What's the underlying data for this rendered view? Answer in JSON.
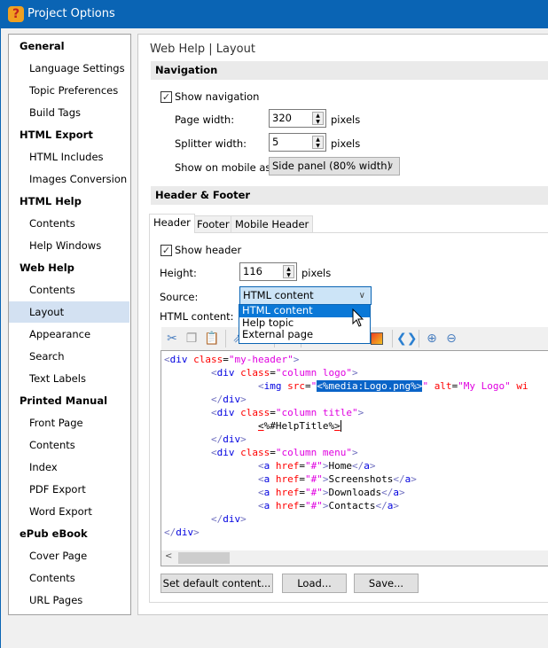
{
  "window": {
    "title": "Project Options",
    "icon": "help-question-icon"
  },
  "sidebar": {
    "items": [
      {
        "label": "General",
        "group": true
      },
      {
        "label": "Language Settings"
      },
      {
        "label": "Topic Preferences"
      },
      {
        "label": "Build Tags"
      },
      {
        "label": "HTML Export",
        "group": true
      },
      {
        "label": "HTML Includes"
      },
      {
        "label": "Images Conversion"
      },
      {
        "label": "HTML Help",
        "group": true
      },
      {
        "label": "Contents"
      },
      {
        "label": "Help Windows"
      },
      {
        "label": "Web Help",
        "group": true
      },
      {
        "label": "Contents"
      },
      {
        "label": "Layout",
        "selected": true
      },
      {
        "label": "Appearance"
      },
      {
        "label": "Search"
      },
      {
        "label": "Text Labels"
      },
      {
        "label": "Printed Manual",
        "group": true
      },
      {
        "label": "Front Page"
      },
      {
        "label": "Contents"
      },
      {
        "label": "Index"
      },
      {
        "label": "PDF Export"
      },
      {
        "label": "Word Export"
      },
      {
        "label": "ePub eBook",
        "group": true
      },
      {
        "label": "Cover Page"
      },
      {
        "label": "Contents"
      },
      {
        "label": "URL Pages"
      }
    ]
  },
  "main": {
    "breadcrumb": "Web Help | Layout",
    "navigation": {
      "section": "Navigation",
      "show_navigation": "Show navigation",
      "show_navigation_checked": true,
      "page_width_label": "Page width:",
      "page_width": "320",
      "splitter_label": "Splitter width:",
      "splitter_width": "5",
      "units": "pixels",
      "mobile_label": "Show on mobile as:",
      "mobile_value": "Side panel (80% width)"
    },
    "header_footer": {
      "section": "Header & Footer",
      "tabs": [
        "Header",
        "Footer",
        "Mobile Header"
      ],
      "active_tab": "Header",
      "show_header": "Show header",
      "show_header_checked": true,
      "height_label": "Height:",
      "height": "116",
      "units": "pixels",
      "source_label": "Source:",
      "source_value": "HTML content",
      "source_options": [
        "HTML content",
        "Help topic",
        "External page"
      ],
      "html_content_label": "HTML content:",
      "toolbar_icons": [
        "cut-icon",
        "copy-icon",
        "paste-icon",
        "link-icon",
        "table-icon",
        "insert-row-icon",
        "colors-icon",
        "color-fill-icon",
        "format-code-icon",
        "zoom-in-icon",
        "zoom-out-icon"
      ],
      "code": [
        [
          [
            "b",
            "<"
          ],
          [
            "t",
            "div"
          ],
          [
            "x",
            " "
          ],
          [
            "a",
            "class"
          ],
          [
            "x",
            "="
          ],
          [
            "v",
            "\"my-header\""
          ],
          [
            "b",
            ">"
          ]
        ],
        [
          [
            "x",
            "        "
          ],
          [
            "b",
            "<"
          ],
          [
            "t",
            "div"
          ],
          [
            "x",
            " "
          ],
          [
            "a",
            "class"
          ],
          [
            "x",
            "="
          ],
          [
            "v",
            "\"column logo\""
          ],
          [
            "b",
            ">"
          ]
        ],
        [
          [
            "x",
            "                "
          ],
          [
            "b",
            "<"
          ],
          [
            "t",
            "img"
          ],
          [
            "x",
            " "
          ],
          [
            "a",
            "src"
          ],
          [
            "x",
            "="
          ],
          [
            "v",
            "\""
          ],
          [
            "s",
            "<%media:Logo.png%>"
          ],
          [
            "v",
            "\""
          ],
          [
            "x",
            " "
          ],
          [
            "a",
            "alt"
          ],
          [
            "x",
            "="
          ],
          [
            "v",
            "\"My Logo\""
          ],
          [
            "x",
            " "
          ],
          [
            "a",
            "wi"
          ]
        ],
        [
          [
            "x",
            "        "
          ],
          [
            "b",
            "</"
          ],
          [
            "t",
            "div"
          ],
          [
            "b",
            ">"
          ]
        ],
        [
          [
            "x",
            "        "
          ],
          [
            "b",
            "<"
          ],
          [
            "t",
            "div"
          ],
          [
            "x",
            " "
          ],
          [
            "a",
            "class"
          ],
          [
            "x",
            "="
          ],
          [
            "v",
            "\"column title\""
          ],
          [
            "b",
            ">"
          ]
        ],
        [
          [
            "x",
            "                "
          ],
          [
            "e",
            "<"
          ],
          [
            "x",
            "%#HelpTitle%"
          ],
          [
            "e",
            ">"
          ]
        ],
        [
          [
            "x",
            "        "
          ],
          [
            "b",
            "</"
          ],
          [
            "t",
            "div"
          ],
          [
            "b",
            ">"
          ]
        ],
        [
          [
            "x",
            "        "
          ],
          [
            "b",
            "<"
          ],
          [
            "t",
            "div"
          ],
          [
            "x",
            " "
          ],
          [
            "a",
            "class"
          ],
          [
            "x",
            "="
          ],
          [
            "v",
            "\"column menu\""
          ],
          [
            "b",
            ">"
          ]
        ],
        [
          [
            "x",
            "                "
          ],
          [
            "b",
            "<"
          ],
          [
            "t",
            "a"
          ],
          [
            "x",
            " "
          ],
          [
            "a",
            "href"
          ],
          [
            "x",
            "="
          ],
          [
            "v",
            "\"#\""
          ],
          [
            "b",
            ">"
          ],
          [
            "x",
            "Home"
          ],
          [
            "b",
            "</"
          ],
          [
            "t",
            "a"
          ],
          [
            "b",
            ">"
          ]
        ],
        [
          [
            "x",
            "                "
          ],
          [
            "b",
            "<"
          ],
          [
            "t",
            "a"
          ],
          [
            "x",
            " "
          ],
          [
            "a",
            "href"
          ],
          [
            "x",
            "="
          ],
          [
            "v",
            "\"#\""
          ],
          [
            "b",
            ">"
          ],
          [
            "x",
            "Screenshots"
          ],
          [
            "b",
            "</"
          ],
          [
            "t",
            "a"
          ],
          [
            "b",
            ">"
          ]
        ],
        [
          [
            "x",
            "                "
          ],
          [
            "b",
            "<"
          ],
          [
            "t",
            "a"
          ],
          [
            "x",
            " "
          ],
          [
            "a",
            "href"
          ],
          [
            "x",
            "="
          ],
          [
            "v",
            "\"#\""
          ],
          [
            "b",
            ">"
          ],
          [
            "x",
            "Downloads"
          ],
          [
            "b",
            "</"
          ],
          [
            "t",
            "a"
          ],
          [
            "b",
            ">"
          ]
        ],
        [
          [
            "x",
            "                "
          ],
          [
            "b",
            "<"
          ],
          [
            "t",
            "a"
          ],
          [
            "x",
            " "
          ],
          [
            "a",
            "href"
          ],
          [
            "x",
            "="
          ],
          [
            "v",
            "\"#\""
          ],
          [
            "b",
            ">"
          ],
          [
            "x",
            "Contacts"
          ],
          [
            "b",
            "</"
          ],
          [
            "t",
            "a"
          ],
          [
            "b",
            ">"
          ]
        ],
        [
          [
            "x",
            "        "
          ],
          [
            "b",
            "</"
          ],
          [
            "t",
            "div"
          ],
          [
            "b",
            ">"
          ]
        ],
        [
          [
            "b",
            "</"
          ],
          [
            "t",
            "div"
          ],
          [
            "b",
            ">"
          ]
        ]
      ],
      "buttons": {
        "set_default": "Set default content...",
        "load": "Load...",
        "save": "Save..."
      }
    }
  }
}
